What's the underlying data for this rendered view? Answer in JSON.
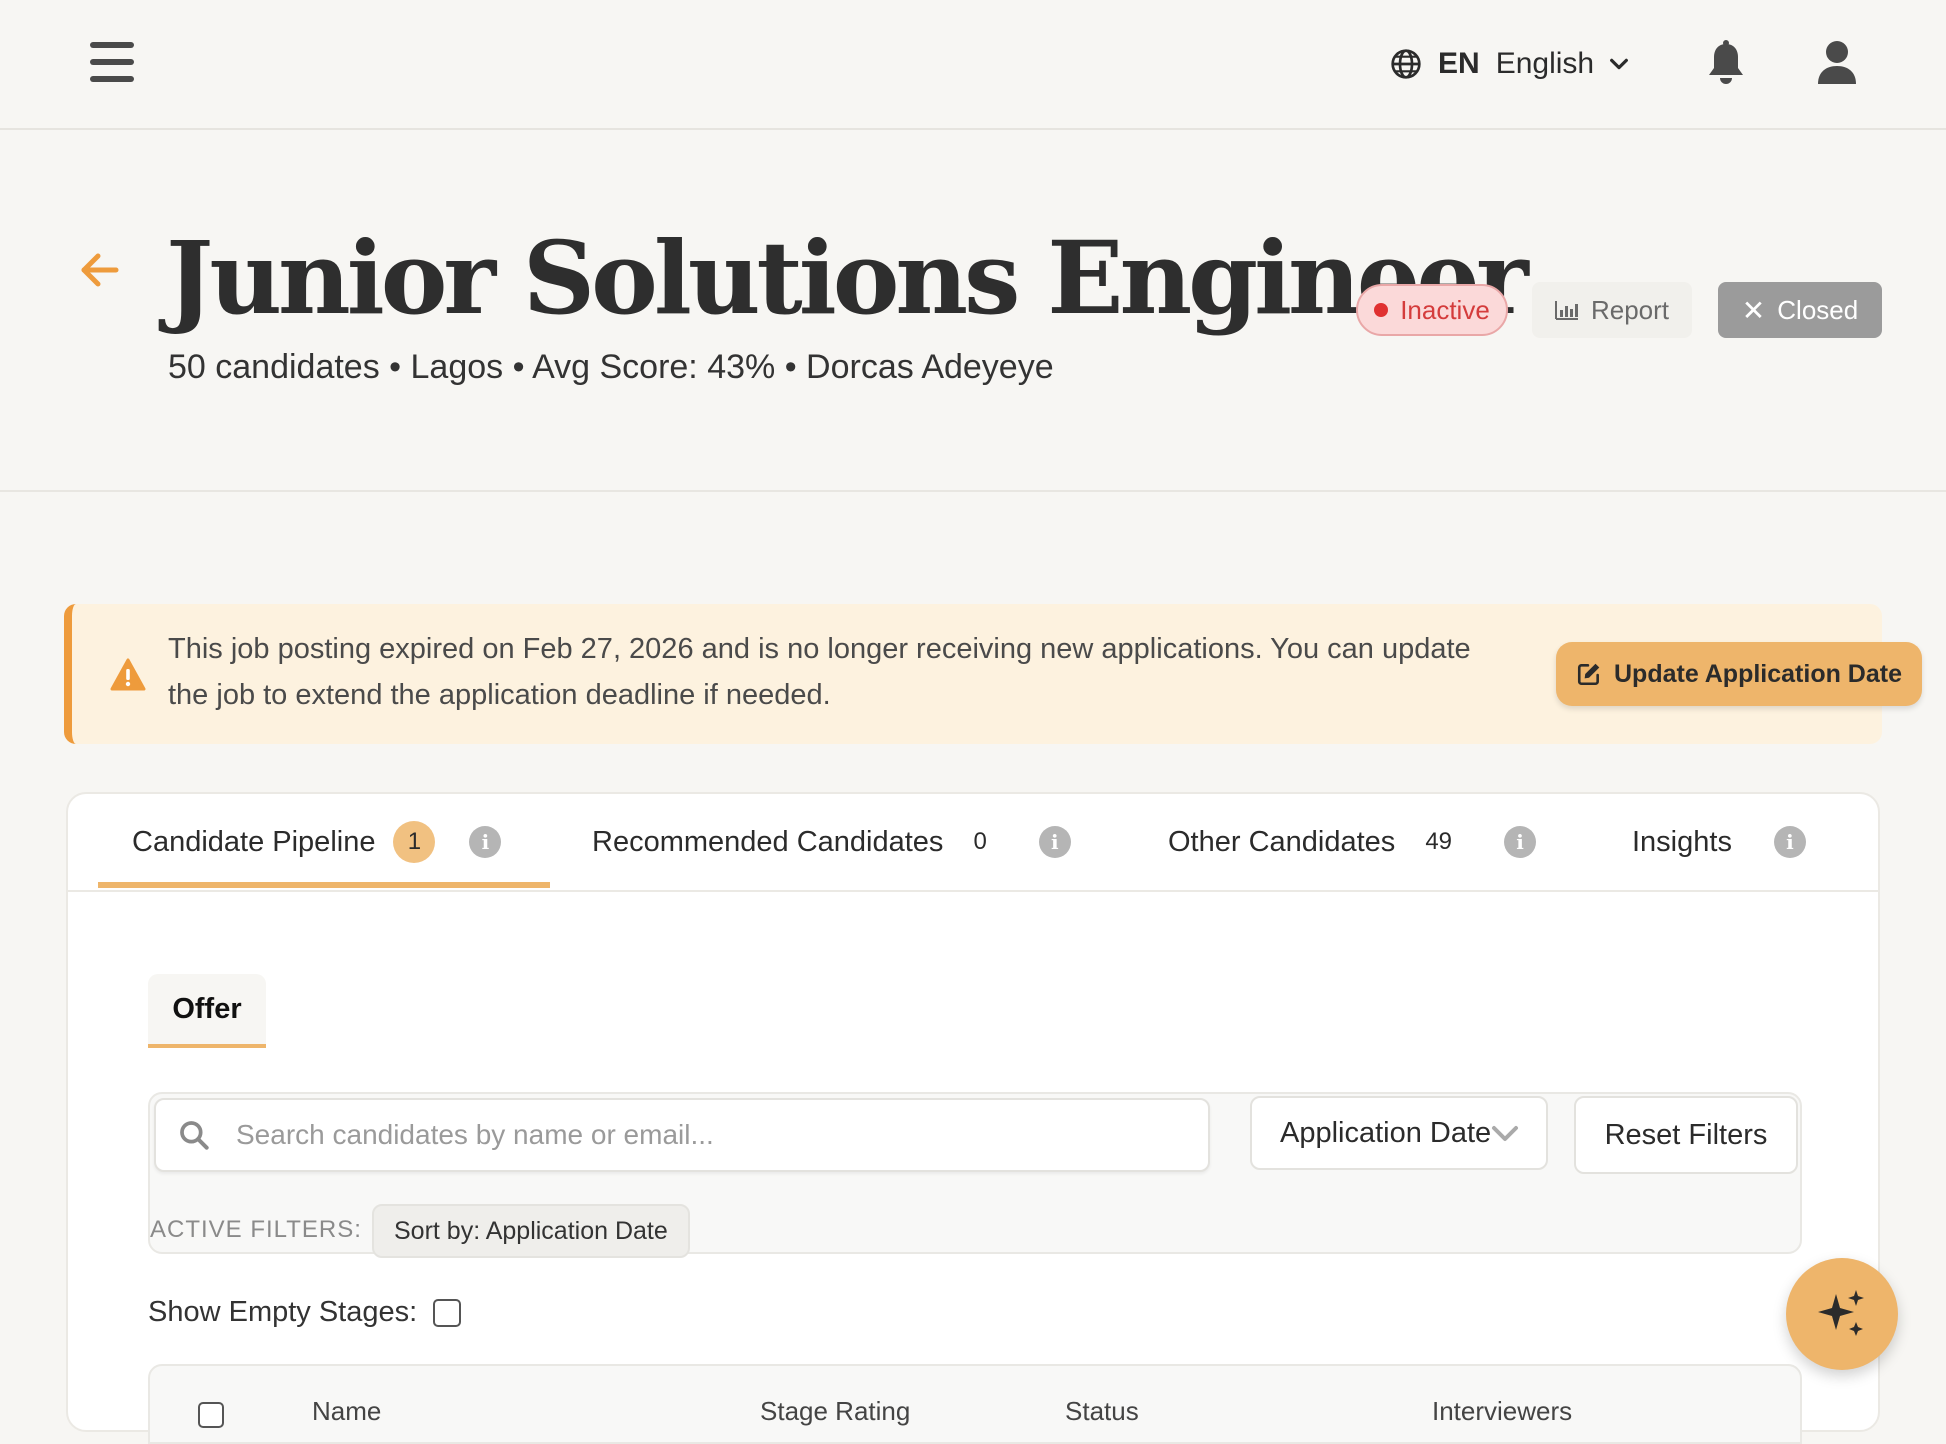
{
  "topbar": {
    "lang_code": "EN",
    "lang_name": "English"
  },
  "header": {
    "title": "Junior Solutions Engineer",
    "meta": "50 candidates • Lagos • Avg Score: 43% • Dorcas Adeyeye",
    "status_badge": "Inactive",
    "report_label": "Report",
    "closed_label": "Closed"
  },
  "alert": {
    "message": "This job posting expired on Feb 27, 2026 and is no longer receiving new applications. You can update the job to extend the application deadline if needed.",
    "button_label": "Update Application Date"
  },
  "tabs": [
    {
      "label": "Candidate Pipeline",
      "count": "1"
    },
    {
      "label": "Recommended Candidates",
      "count": "0"
    },
    {
      "label": "Other Candidates",
      "count": "49"
    },
    {
      "label": "Insights"
    }
  ],
  "stage": {
    "active_label": "Offer"
  },
  "filters": {
    "search_placeholder": "Search candidates by name or email...",
    "sort_selected": "Application Date",
    "reset_label": "Reset Filters",
    "active_filters_label": "ACTIVE FILTERS:",
    "chip_label": "Sort by: Application Date"
  },
  "options": {
    "show_empty_label": "Show Empty Stages:"
  },
  "table": {
    "columns": [
      "Name",
      "Stage Rating",
      "Status",
      "Interviewers"
    ]
  },
  "colors": {
    "accent": "#eeb56b",
    "alert_border": "#ee9b3c",
    "inactive": "#e03131"
  },
  "icons": {
    "menu": "hamburger-icon",
    "language": "globe-icon",
    "notifications": "bell-icon",
    "account": "user-icon",
    "back": "arrow-left-icon",
    "fab": "sparkles-icon"
  }
}
